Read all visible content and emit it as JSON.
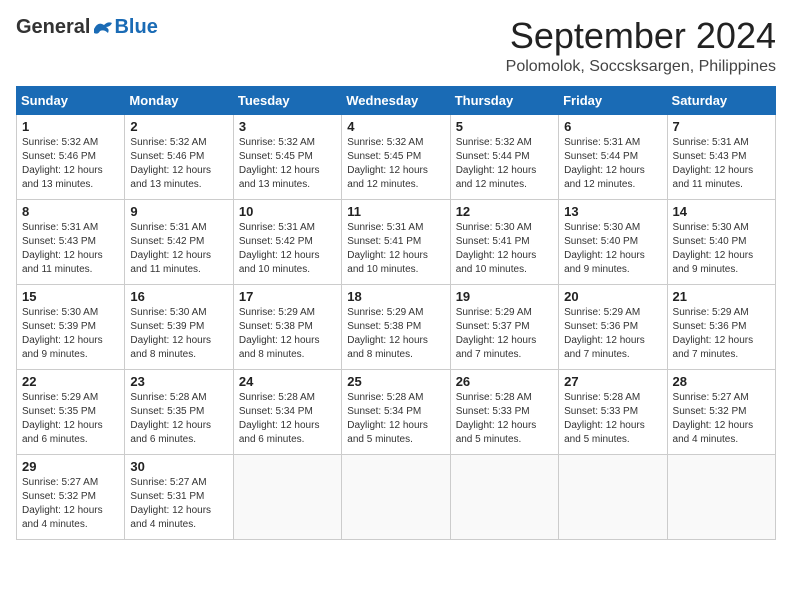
{
  "header": {
    "logo_general": "General",
    "logo_blue": "Blue",
    "month_title": "September 2024",
    "location": "Polomolok, Soccsksargen, Philippines"
  },
  "weekdays": [
    "Sunday",
    "Monday",
    "Tuesday",
    "Wednesday",
    "Thursday",
    "Friday",
    "Saturday"
  ],
  "weeks": [
    [
      {
        "day": "1",
        "sunrise": "5:32 AM",
        "sunset": "5:46 PM",
        "daylight": "12 hours and 13 minutes."
      },
      {
        "day": "2",
        "sunrise": "5:32 AM",
        "sunset": "5:46 PM",
        "daylight": "12 hours and 13 minutes."
      },
      {
        "day": "3",
        "sunrise": "5:32 AM",
        "sunset": "5:45 PM",
        "daylight": "12 hours and 13 minutes."
      },
      {
        "day": "4",
        "sunrise": "5:32 AM",
        "sunset": "5:45 PM",
        "daylight": "12 hours and 12 minutes."
      },
      {
        "day": "5",
        "sunrise": "5:32 AM",
        "sunset": "5:44 PM",
        "daylight": "12 hours and 12 minutes."
      },
      {
        "day": "6",
        "sunrise": "5:31 AM",
        "sunset": "5:44 PM",
        "daylight": "12 hours and 12 minutes."
      },
      {
        "day": "7",
        "sunrise": "5:31 AM",
        "sunset": "5:43 PM",
        "daylight": "12 hours and 11 minutes."
      }
    ],
    [
      {
        "day": "8",
        "sunrise": "5:31 AM",
        "sunset": "5:43 PM",
        "daylight": "12 hours and 11 minutes."
      },
      {
        "day": "9",
        "sunrise": "5:31 AM",
        "sunset": "5:42 PM",
        "daylight": "12 hours and 11 minutes."
      },
      {
        "day": "10",
        "sunrise": "5:31 AM",
        "sunset": "5:42 PM",
        "daylight": "12 hours and 10 minutes."
      },
      {
        "day": "11",
        "sunrise": "5:31 AM",
        "sunset": "5:41 PM",
        "daylight": "12 hours and 10 minutes."
      },
      {
        "day": "12",
        "sunrise": "5:30 AM",
        "sunset": "5:41 PM",
        "daylight": "12 hours and 10 minutes."
      },
      {
        "day": "13",
        "sunrise": "5:30 AM",
        "sunset": "5:40 PM",
        "daylight": "12 hours and 9 minutes."
      },
      {
        "day": "14",
        "sunrise": "5:30 AM",
        "sunset": "5:40 PM",
        "daylight": "12 hours and 9 minutes."
      }
    ],
    [
      {
        "day": "15",
        "sunrise": "5:30 AM",
        "sunset": "5:39 PM",
        "daylight": "12 hours and 9 minutes."
      },
      {
        "day": "16",
        "sunrise": "5:30 AM",
        "sunset": "5:39 PM",
        "daylight": "12 hours and 8 minutes."
      },
      {
        "day": "17",
        "sunrise": "5:29 AM",
        "sunset": "5:38 PM",
        "daylight": "12 hours and 8 minutes."
      },
      {
        "day": "18",
        "sunrise": "5:29 AM",
        "sunset": "5:38 PM",
        "daylight": "12 hours and 8 minutes."
      },
      {
        "day": "19",
        "sunrise": "5:29 AM",
        "sunset": "5:37 PM",
        "daylight": "12 hours and 7 minutes."
      },
      {
        "day": "20",
        "sunrise": "5:29 AM",
        "sunset": "5:36 PM",
        "daylight": "12 hours and 7 minutes."
      },
      {
        "day": "21",
        "sunrise": "5:29 AM",
        "sunset": "5:36 PM",
        "daylight": "12 hours and 7 minutes."
      }
    ],
    [
      {
        "day": "22",
        "sunrise": "5:29 AM",
        "sunset": "5:35 PM",
        "daylight": "12 hours and 6 minutes."
      },
      {
        "day": "23",
        "sunrise": "5:28 AM",
        "sunset": "5:35 PM",
        "daylight": "12 hours and 6 minutes."
      },
      {
        "day": "24",
        "sunrise": "5:28 AM",
        "sunset": "5:34 PM",
        "daylight": "12 hours and 6 minutes."
      },
      {
        "day": "25",
        "sunrise": "5:28 AM",
        "sunset": "5:34 PM",
        "daylight": "12 hours and 5 minutes."
      },
      {
        "day": "26",
        "sunrise": "5:28 AM",
        "sunset": "5:33 PM",
        "daylight": "12 hours and 5 minutes."
      },
      {
        "day": "27",
        "sunrise": "5:28 AM",
        "sunset": "5:33 PM",
        "daylight": "12 hours and 5 minutes."
      },
      {
        "day": "28",
        "sunrise": "5:27 AM",
        "sunset": "5:32 PM",
        "daylight": "12 hours and 4 minutes."
      }
    ],
    [
      {
        "day": "29",
        "sunrise": "5:27 AM",
        "sunset": "5:32 PM",
        "daylight": "12 hours and 4 minutes."
      },
      {
        "day": "30",
        "sunrise": "5:27 AM",
        "sunset": "5:31 PM",
        "daylight": "12 hours and 4 minutes."
      },
      null,
      null,
      null,
      null,
      null
    ]
  ]
}
